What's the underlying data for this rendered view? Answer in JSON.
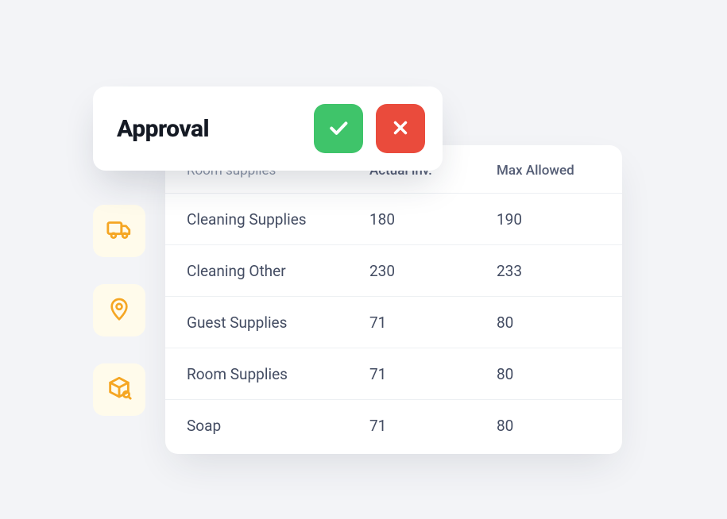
{
  "approval": {
    "title": "Approval"
  },
  "table": {
    "headers": {
      "col0": "Room supplies",
      "col1": "Actual inv.",
      "col2": "Max Allowed"
    },
    "rows": [
      {
        "name": "Cleaning Supplies",
        "actual": "180",
        "max": "190"
      },
      {
        "name": "Cleaning Other",
        "actual": "230",
        "max": "233"
      },
      {
        "name": "Guest Supplies",
        "actual": "71",
        "max": "80"
      },
      {
        "name": "Room Supplies",
        "actual": "71",
        "max": "80"
      },
      {
        "name": "Soap",
        "actual": "71",
        "max": "80"
      }
    ]
  }
}
